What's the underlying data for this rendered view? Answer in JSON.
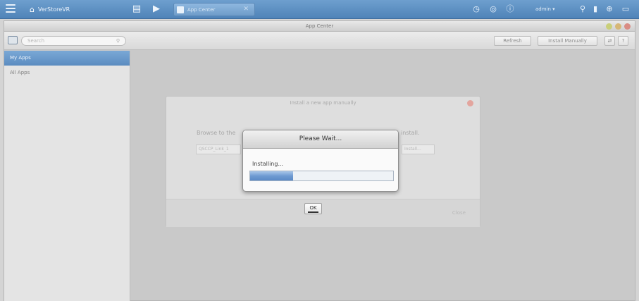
{
  "taskbar": {
    "home_label": "VerStoreVR",
    "tab_label": "App Center",
    "user_label": "admin"
  },
  "window": {
    "title": "App Center",
    "search_placeholder": "Search",
    "refresh_label": "Refresh",
    "install_manually_label": "Install Manually"
  },
  "sidebar": {
    "items": [
      {
        "label": "My Apps"
      },
      {
        "label": "All Apps"
      }
    ]
  },
  "install_dialog": {
    "title": "Install a new app manually",
    "browse_text": "Browse to the",
    "install_text": "install.",
    "field_value": "QSCCP_Link_1",
    "browse_button": "Install...",
    "ok_label": "OK",
    "close_label": "Close"
  },
  "wait_dialog": {
    "title": "Please Wait...",
    "message": "Installing...",
    "progress": 0.3
  },
  "colors": {
    "taskbar": "#5f91c4",
    "selection": "#6b9acb",
    "progress": "#6f9bd2"
  }
}
